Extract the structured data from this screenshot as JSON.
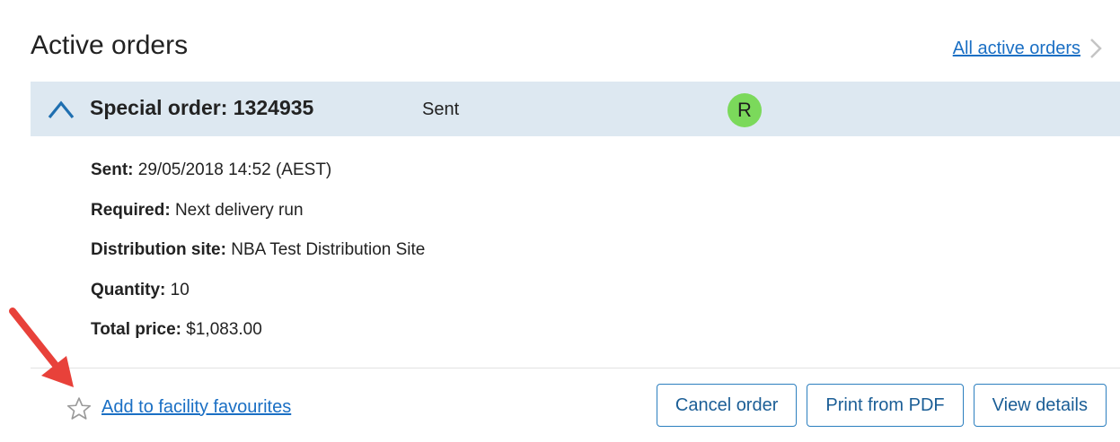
{
  "page": {
    "title": "Active orders",
    "all_orders_link": "All active orders"
  },
  "order": {
    "title": "Special order: 1324935",
    "status": "Sent",
    "avatar_initial": "R",
    "avatar_color": "#7bd95b",
    "header_bg": "#dde8f1",
    "details": [
      {
        "label": "Sent:",
        "value": "29/05/2018 14:52 (AEST)"
      },
      {
        "label": "Required:",
        "value": "Next delivery run"
      },
      {
        "label": "Distribution site:",
        "value": "NBA Test Distribution Site"
      },
      {
        "label": "Quantity:",
        "value": "10"
      },
      {
        "label": "Total price:",
        "value": "$1,083.00"
      }
    ]
  },
  "footer": {
    "favourite_link": "Add to facility favourites",
    "favourite_icon": "star-outline-icon",
    "buttons": {
      "cancel": "Cancel order",
      "print": "Print from PDF",
      "view": "View details"
    }
  },
  "colors": {
    "link": "#1a6fc4",
    "button_border": "#2c7fbf",
    "annotation_arrow": "#e8413a"
  }
}
